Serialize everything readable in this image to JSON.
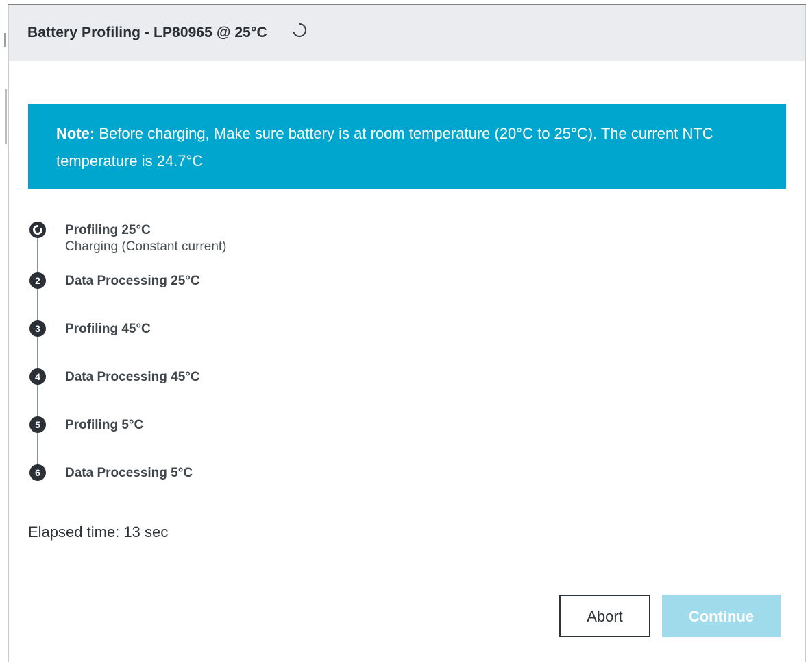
{
  "dialog": {
    "title": "Battery Profiling - LP80965 @ 25°C",
    "note_prefix": "Note:",
    "note_text": " Before charging, Make sure battery is at room temperature (20°C to 25°C). The current NTC temperature is 24.7°C",
    "steps": [
      {
        "number": "1",
        "label": "Profiling 25°C",
        "sublabel": "Charging (Constant current)",
        "state": "active"
      },
      {
        "number": "2",
        "label": "Data Processing 25°C",
        "sublabel": "",
        "state": "pending"
      },
      {
        "number": "3",
        "label": "Profiling 45°C",
        "sublabel": "",
        "state": "pending"
      },
      {
        "number": "4",
        "label": "Data Processing 45°C",
        "sublabel": "",
        "state": "pending"
      },
      {
        "number": "5",
        "label": "Profiling 5°C",
        "sublabel": "",
        "state": "pending"
      },
      {
        "number": "6",
        "label": "Data Processing 5°C",
        "sublabel": "",
        "state": "pending"
      }
    ],
    "elapsed": "Elapsed time: 13 sec",
    "abort_label": "Abort",
    "continue_label": "Continue"
  },
  "colors": {
    "note_background": "#00a6ce",
    "header_background": "#ebecef",
    "continue_disabled": "#9fdbea",
    "step_circle": "#2b3036"
  },
  "icons": {
    "spinner": "loading-spinner-icon",
    "active_step": "progress-ring-icon"
  }
}
